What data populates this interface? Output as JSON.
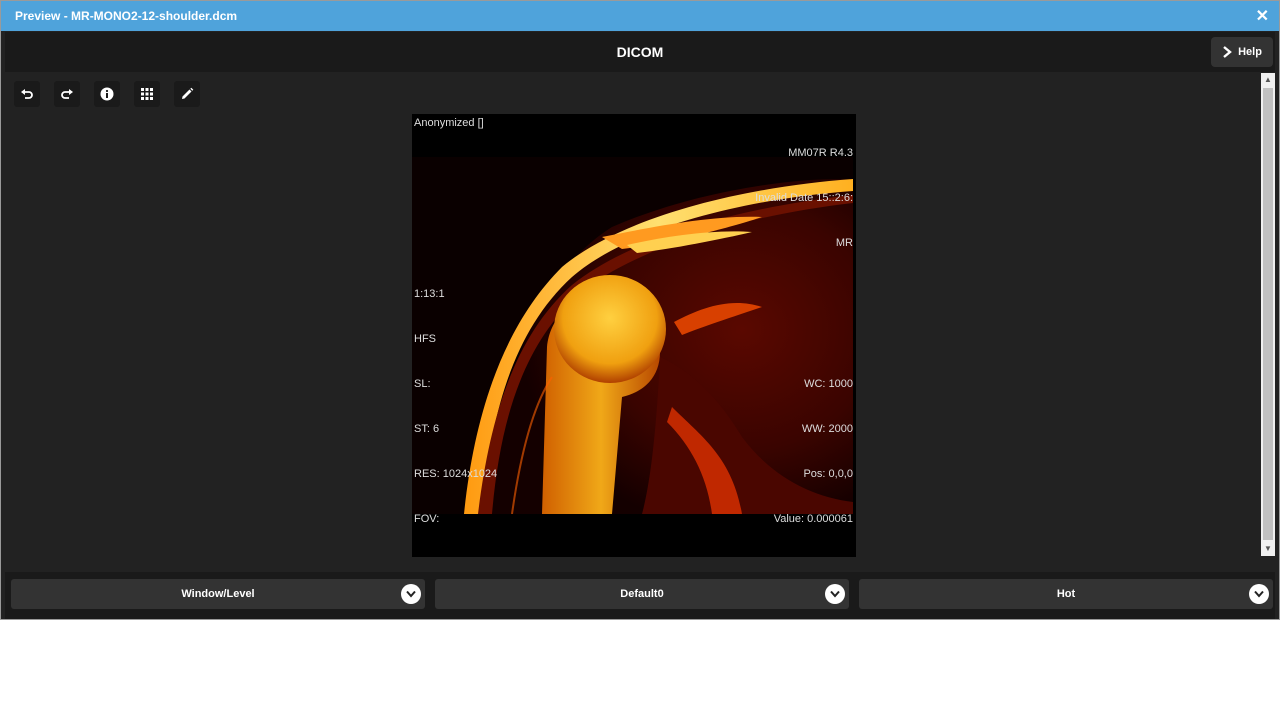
{
  "window": {
    "title": "Preview - MR-MONO2-12-shoulder.dcm",
    "close_glyph": "✕"
  },
  "header": {
    "title": "DICOM",
    "help_label": "Help"
  },
  "toolbar": {
    "tools": [
      "undo-icon",
      "redo-icon",
      "info-icon",
      "grid-icon",
      "pencil-icon"
    ]
  },
  "overlay": {
    "top_left": [
      "Anonymized []"
    ],
    "top_right": [
      "MM07R R4.3",
      "Invalid Date 15::2:6:",
      "MR"
    ],
    "bottom_left": [
      "1:13:1",
      "HFS",
      "SL:",
      "ST: 6",
      "RES: 1024x1024",
      "FOV:"
    ],
    "bottom_right": [
      "WC: 1000",
      "WW: 2000",
      "Pos: 0,0,0",
      "Value: 0.000061"
    ]
  },
  "bottom": {
    "tool_select": "Window/Level",
    "preset_select": "Default0",
    "colormap_select": "Hot"
  },
  "colors": {
    "titlebar": "#4fa3db",
    "background": "#222222",
    "panel": "#1a1a1a"
  }
}
